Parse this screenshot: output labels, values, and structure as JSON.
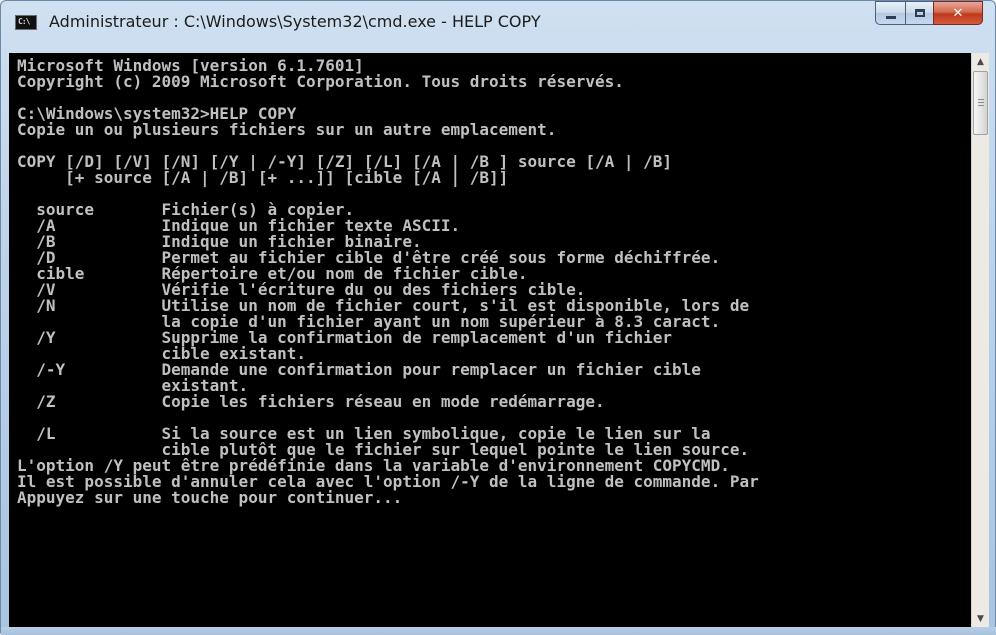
{
  "window": {
    "title": "Administrateur : C:\\Windows\\System32\\cmd.exe - HELP  COPY",
    "icon_text": "C:\\"
  },
  "console": {
    "lines": [
      "Microsoft Windows [version 6.1.7601]",
      "Copyright (c) 2009 Microsoft Corporation. Tous droits réservés.",
      "",
      "C:\\Windows\\system32>HELP COPY",
      "Copie un ou plusieurs fichiers sur un autre emplacement.",
      "",
      "COPY [/D] [/V] [/N] [/Y | /-Y] [/Z] [/L] [/A | /B ] source [/A | /B]",
      "     [+ source [/A | /B] [+ ...]] [cible [/A | /B]]",
      "",
      "  source       Fichier(s) à copier.",
      "  /A           Indique un fichier texte ASCII.",
      "  /B           Indique un fichier binaire.",
      "  /D           Permet au fichier cible d'être créé sous forme déchiffrée.",
      "  cible        Répertoire et/ou nom de fichier cible.",
      "  /V           Vérifie l'écriture du ou des fichiers cible.",
      "  /N           Utilise un nom de fichier court, s'il est disponible, lors de",
      "               la copie d'un fichier ayant un nom supérieur à 8.3 caract.",
      "  /Y           Supprime la confirmation de remplacement d'un fichier",
      "               cible existant.",
      "  /-Y          Demande une confirmation pour remplacer un fichier cible",
      "               existant.",
      "  /Z           Copie les fichiers réseau en mode redémarrage.",
      "",
      "  /L           Si la source est un lien symbolique, copie le lien sur la",
      "               cible plutôt que le fichier sur lequel pointe le lien source.",
      "L'option /Y peut être prédéfinie dans la variable d'environnement COPYCMD.",
      "Il est possible d'annuler cela avec l'option /-Y de la ligne de commande. Par",
      "Appuyez sur une touche pour continuer..."
    ]
  }
}
